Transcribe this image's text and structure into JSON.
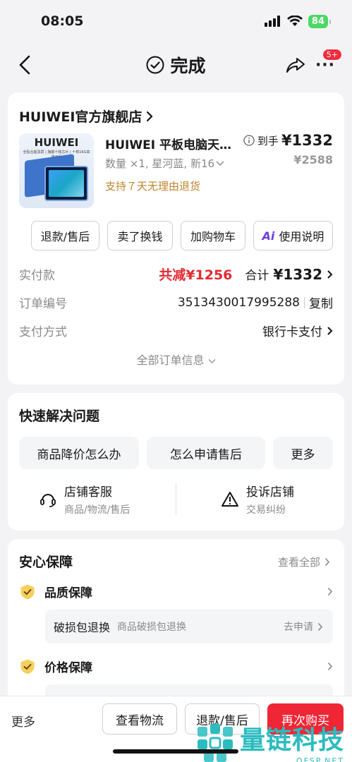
{
  "status": {
    "time": "08:05",
    "battery": "84"
  },
  "nav": {
    "title": "完成",
    "badge": "5+"
  },
  "order": {
    "shop_name": "HUIWEI官方旗舰店",
    "product": {
      "image_brand": "HUIWEI",
      "image_subtitle": "全贴合超清屏 | 旗舰十核芯片 | 十核16G高速运行",
      "title": "HUIWEI 平板电脑天…",
      "spec": "数量 ×1, 星河蓝, 新16",
      "return_policy": "支持７天无理由退货",
      "final_price_label": "到手",
      "final_price": "¥1332",
      "original_price": "¥2588"
    },
    "actions": [
      "退款/售后",
      "卖了换钱",
      "加购物车",
      "使用说明"
    ],
    "paid_label": "实付款",
    "discount": "共减¥1256",
    "total_label": "合计",
    "total": "¥1332",
    "order_no_label": "订单编号",
    "order_no": "3513430017995288",
    "copy_label": "复制",
    "pay_method_label": "支付方式",
    "pay_method": "银行卡支付",
    "all_info": "全部订单信息"
  },
  "quick": {
    "title": "快速解决问题",
    "buttons": [
      "商品降价怎么办",
      "怎么申请售后",
      "更多"
    ],
    "services": [
      {
        "title": "店铺客服",
        "sub": "商品/物流/售后"
      },
      {
        "title": "投诉店铺",
        "sub": "交易纠纷"
      }
    ]
  },
  "guarantee": {
    "title": "安心保障",
    "view_all": "查看全部",
    "items": [
      {
        "title": "品质保障",
        "sub_title": "破损包退换",
        "sub_desc": "商品破损包退换",
        "sub_action": "去申请"
      },
      {
        "title": "价格保障"
      }
    ]
  },
  "bottom": {
    "more": "更多",
    "logistics": "查看物流",
    "refund": "退款/售后",
    "rebuy": "再次购买"
  },
  "watermark": {
    "text": "量链科技",
    "url": "QFSP.NET"
  },
  "colors": {
    "accent_red": "#ef2636",
    "price_red": "#e22b33",
    "return_gold": "#c0832c",
    "shield_yellow": "#f6cf5c"
  }
}
